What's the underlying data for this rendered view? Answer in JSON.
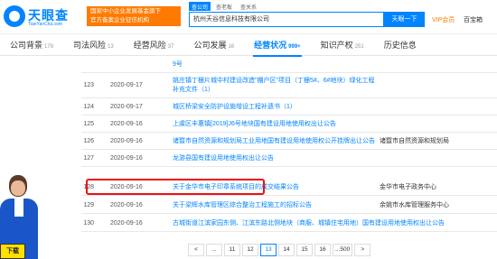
{
  "header": {
    "brand": "天眼查",
    "domain": "TianYanCha.com",
    "gov_badge_line1": "国家中小企业发展基金旗下",
    "gov_badge_line2": "官方备案企业征信机构",
    "search_tabs": [
      "查公司",
      "查老板",
      "查关系"
    ],
    "search_value": "杭州天谷信息科技有限公司",
    "search_button": "天眼一下",
    "vip_label": "VIP会员",
    "baike_label": "百宝箱"
  },
  "tabs": [
    {
      "label": "公司背景",
      "count": "179"
    },
    {
      "label": "司法风险",
      "count": "13"
    },
    {
      "label": "经营风险",
      "count": "37"
    },
    {
      "label": "公司发展",
      "count": "16"
    },
    {
      "label": "经营状况",
      "count": "999+"
    },
    {
      "label": "知识产权",
      "count": "251"
    },
    {
      "label": "历史信息",
      "count": ""
    }
  ],
  "rows": [
    {
      "no": "",
      "date": "",
      "title": "9号",
      "org": ""
    },
    {
      "no": "123",
      "date": "2020-09-17",
      "title": "姚庄镇丁栅片城中村建设改造\"棚户区\"项目（丁栅5#、6#地块）绿化工程补充文件（1）",
      "org": ""
    },
    {
      "no": "124",
      "date": "2020-09-17",
      "title": "城区桥梁安全防护设施增设工程补遗书（1）",
      "org": ""
    },
    {
      "no": "125",
      "date": "2020-09-16",
      "title": "上虞区丰惠镇[2019]J6号地块国有建设用地使用权出让公告",
      "org": ""
    },
    {
      "no": "126",
      "date": "2020-09-16",
      "title": "诸暨市自然资源和规划局工业用地国有建设用地使用权公开挂牌出让公告",
      "org": "诸暨市自然资源和规划局"
    },
    {
      "no": "127",
      "date": "2020-09-16",
      "title": "龙游县国有建设用地使用权出让公告",
      "org": ""
    },
    {
      "no": "128",
      "date": "2020-09-16",
      "title": "关于金华市电子印章系统项目的成交结果公告",
      "org": "金华市电子政务中心"
    },
    {
      "no": "129",
      "date": "2020-09-16",
      "title": "关于梁辉水库管理区综合整治工程施工的招标公告",
      "org": "余姚市水库管理服务中心"
    },
    {
      "no": "130",
      "date": "2020-09-16",
      "title": "古城街道江滨家园东侧、江滨东路北侧地块（商服、城镇住宅用地）国有建设用地使用权出让公告",
      "org": ""
    }
  ],
  "pager": [
    "<",
    "...",
    "11",
    "12",
    "13",
    "14",
    "15",
    "16",
    "...500",
    ">"
  ],
  "current_page": "13",
  "promo": {
    "cta": "下载"
  },
  "colors": {
    "brand_blue": "#0084ff",
    "orange": "#ff7a00",
    "highlight_red": "#e11111"
  }
}
